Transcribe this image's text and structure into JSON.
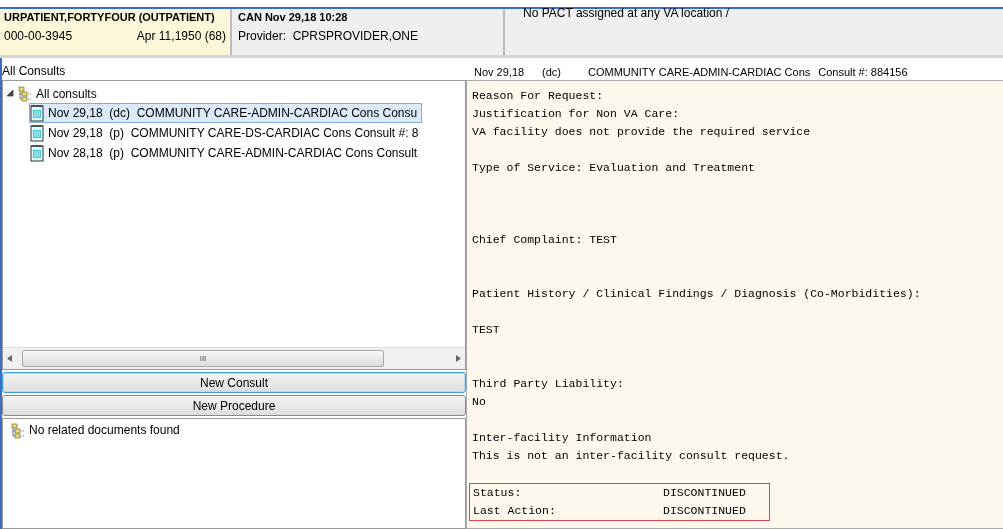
{
  "patient": {
    "name": "URPATIENT,FORTYFOUR (OUTPATIENT)",
    "ssn": "000-00-3945",
    "dob": "Apr 11,1950 (68)"
  },
  "encounter": {
    "title": "CAN Nov 29,18 10:28",
    "provider": "Provider:  CPRSPROVIDER,ONE"
  },
  "pact": {
    "text": "No PACT assigned at any VA location /"
  },
  "consults": {
    "title": "All Consults",
    "root": {
      "label": "All consults",
      "expanded": true,
      "children": [
        {
          "label": "Nov 29,18  (dc)  COMMUNITY CARE-ADMIN-CARDIAC Cons Consu",
          "selected": true
        },
        {
          "label": "Nov 29,18  (p)  COMMUNITY CARE-DS-CARDIAC Cons Consult #: 8",
          "selected": false
        },
        {
          "label": "Nov 28,18  (p)  COMMUNITY CARE-ADMIN-CARDIAC Cons Consult",
          "selected": false
        }
      ]
    },
    "scroll_grip": "III"
  },
  "buttons": [
    {
      "label": "New Consult",
      "focused": true
    },
    {
      "label": "New Procedure",
      "focused": false
    }
  ],
  "related": {
    "label": "No related documents found"
  },
  "detail": {
    "header": [
      "Nov 29,18",
      "(dc)",
      "COMMUNITY CARE-ADMIN-CARDIAC Cons",
      "Consult #: 884156"
    ],
    "blocks": [
      {
        "kind": "text",
        "lines": [
          "Reason For Request:",
          "Justification for Non VA Care:",
          "VA facility does not provide the required service"
        ]
      },
      {
        "kind": "text",
        "lines": [
          "Type of Service: Evaluation and Treatment"
        ]
      },
      {
        "kind": "text",
        "lines": [
          "Chief Complaint: TEST"
        ]
      },
      {
        "kind": "text",
        "lines": [
          "Patient History / Clinical Findings / Diagnosis (Co-Morbidities):"
        ]
      },
      {
        "kind": "text",
        "lines": [
          "TEST"
        ]
      },
      {
        "kind": "text",
        "lines": [
          "Third Party Liability:",
          "No"
        ]
      },
      {
        "kind": "text",
        "lines": [
          "Inter-facility Information",
          "This is not an inter-facility consult request."
        ]
      },
      {
        "kind": "status",
        "rows": [
          {
            "label": "Status:",
            "value": "DISCONTINUED"
          },
          {
            "label": "Last Action:",
            "value": "DISCONTINUED"
          }
        ]
      }
    ]
  }
}
